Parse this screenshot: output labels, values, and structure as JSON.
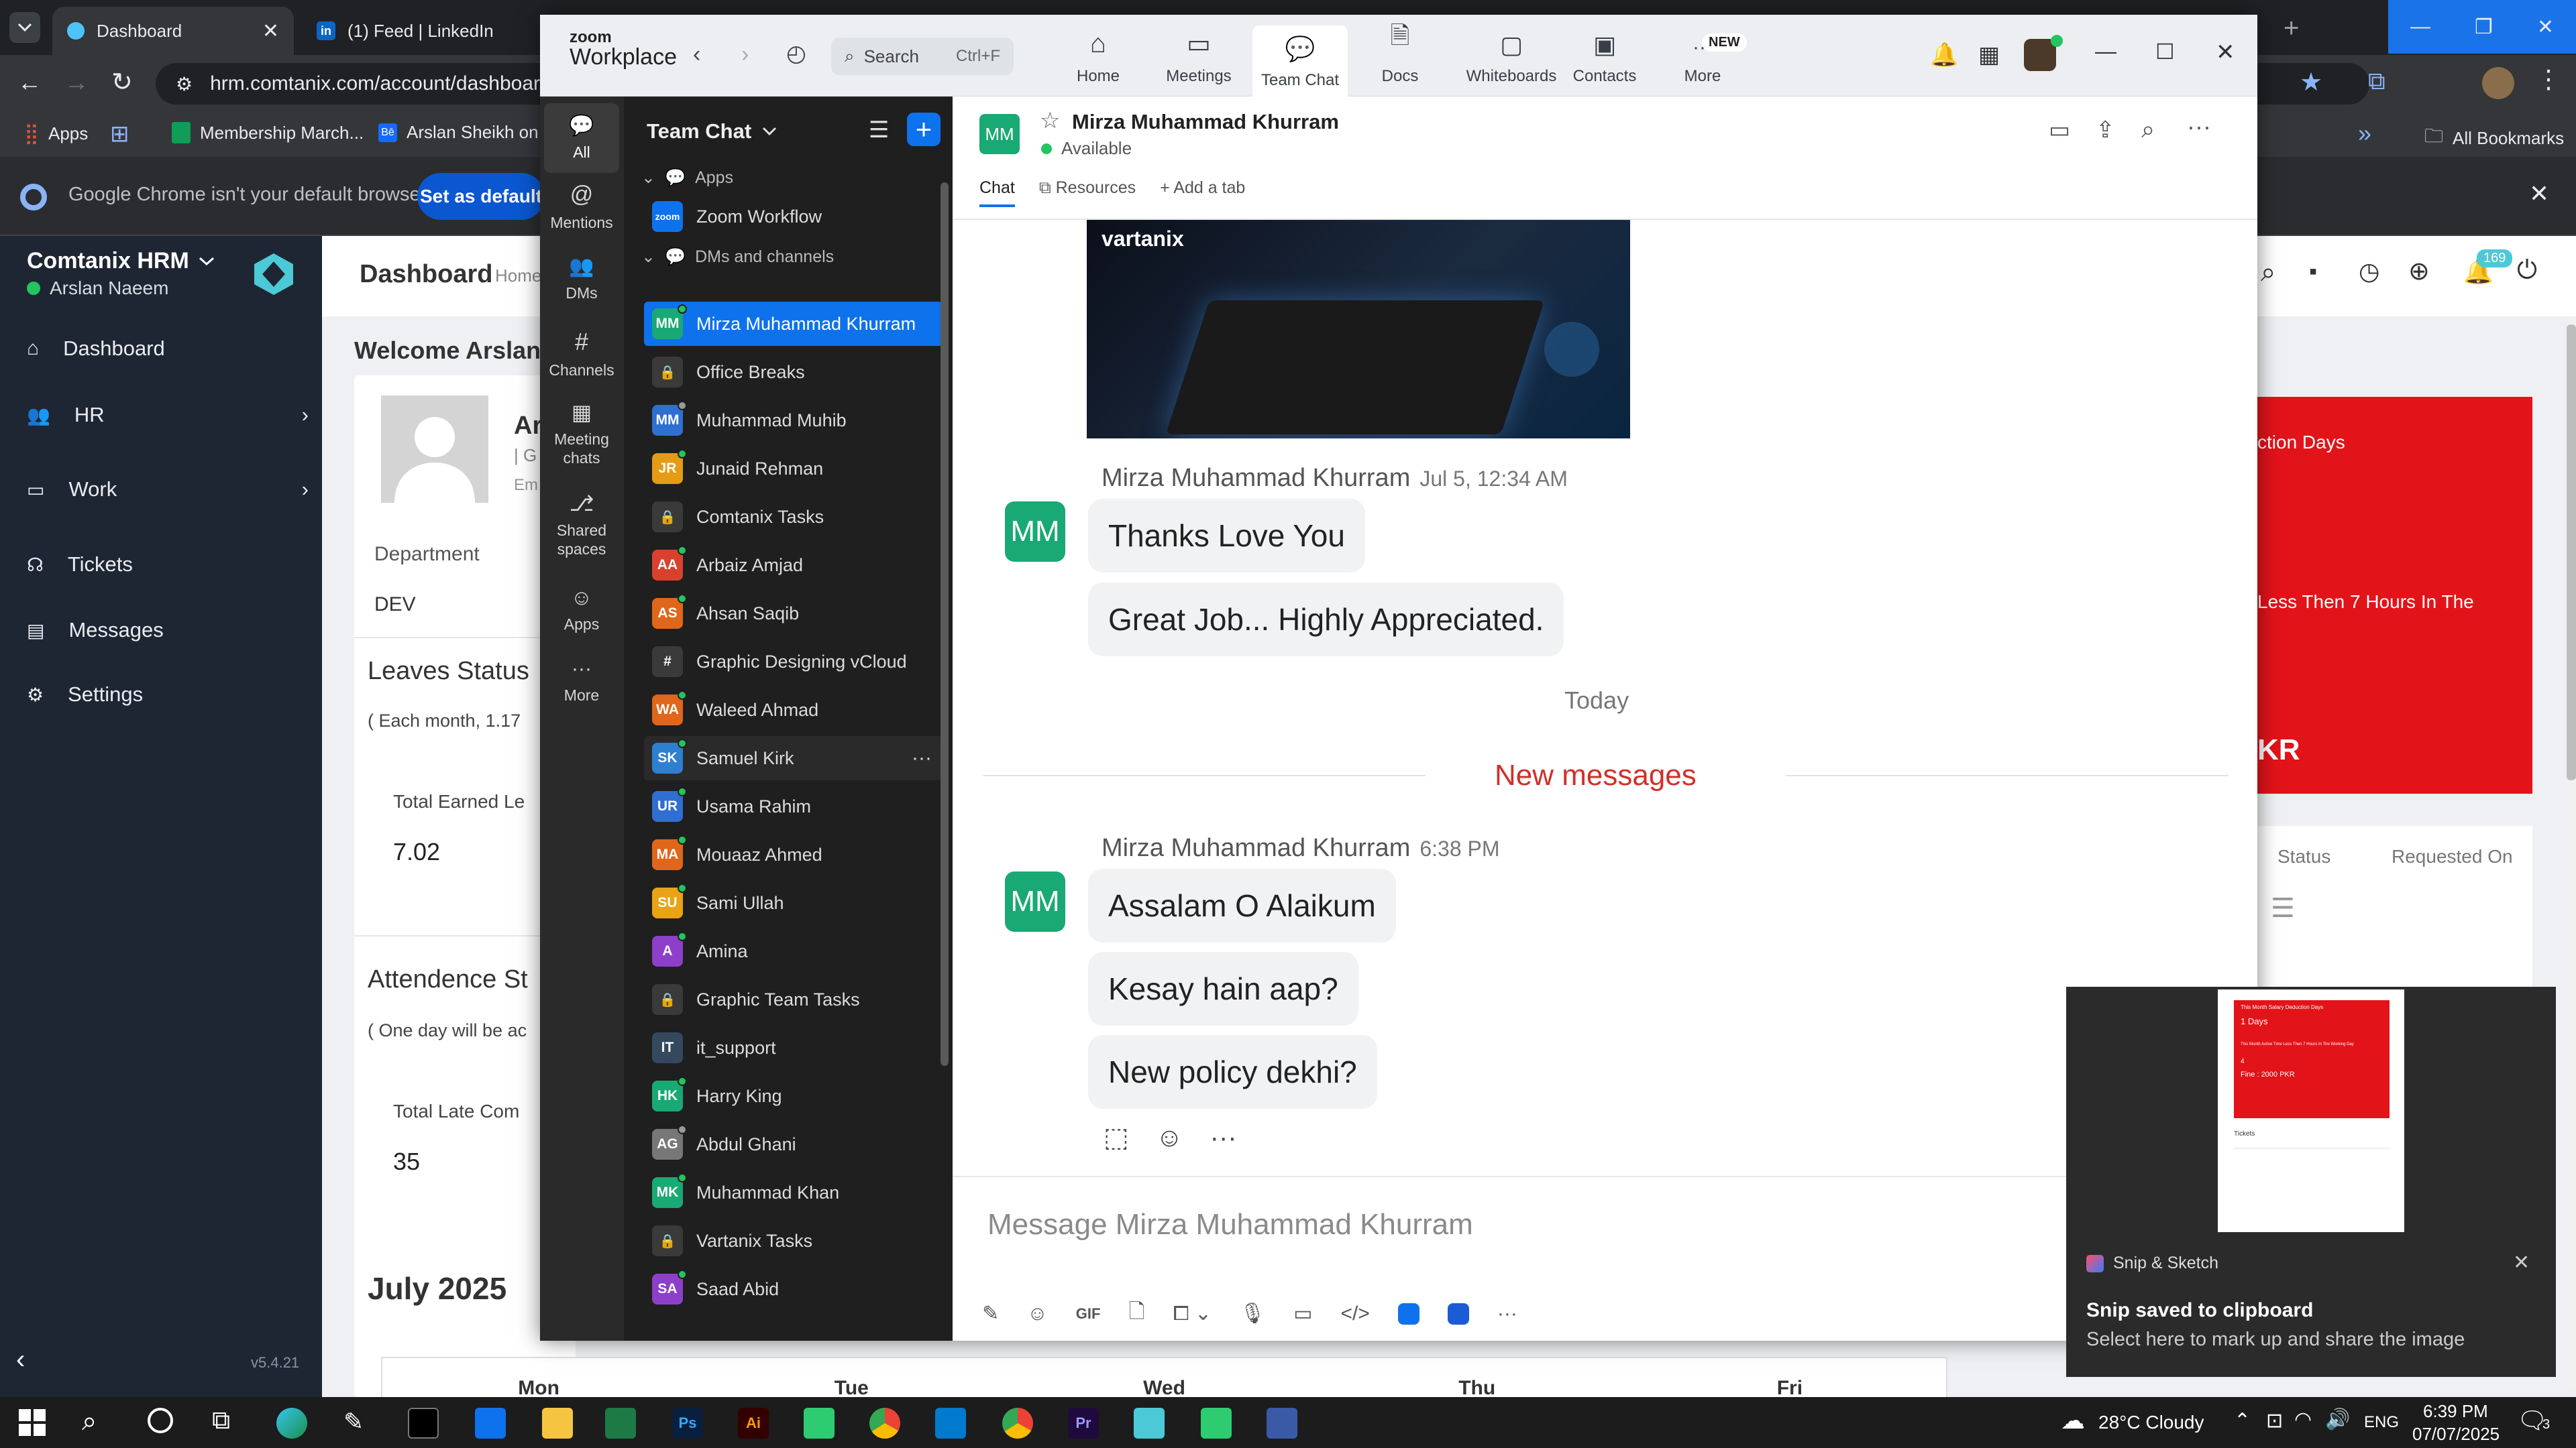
{
  "browser": {
    "tabs": [
      {
        "title": "Dashboard"
      },
      {
        "title": "(1) Feed | LinkedIn"
      }
    ],
    "url": "hrm.comtanix.com/account/dashboard",
    "bookmarks": [
      {
        "label": "Apps"
      },
      {
        "label": "Membership March..."
      },
      {
        "label": "Arslan Sheikh on E..."
      }
    ],
    "all_bookmarks": "All Bookmarks",
    "default_notice": "Google Chrome isn't your default browser",
    "set_default": "Set as default"
  },
  "hrm": {
    "brand": "Comtanix HRM",
    "user": "Arslan Naeem",
    "version": "v5.4.21",
    "nav": [
      {
        "label": "Dashboard"
      },
      {
        "label": "HR"
      },
      {
        "label": "Work"
      },
      {
        "label": "Tickets"
      },
      {
        "label": "Messages"
      },
      {
        "label": "Settings"
      }
    ],
    "page_title": "Dashboard",
    "breadcrumb": "Home",
    "welcome": "Welcome Arslan",
    "profile_initial": "Ar",
    "profile_sub": "| G",
    "profile_em": "Em",
    "department_label": "Department",
    "department_value": "DEV",
    "leaves_title": "Leaves Status",
    "leaves_note": "( Each month, 1.17",
    "total_earned_label": "Total Earned Le",
    "total_earned_value": "7.02",
    "attendance_title": "Attendence St",
    "attendance_note": "( One day will be ac",
    "total_late_label": "Total Late Com",
    "total_late_value": "35",
    "calendar_title": "July 2025",
    "weekdays": [
      "Mon",
      "Tue",
      "Wed",
      "Thu",
      "Fri"
    ],
    "red_card": {
      "line1": "ction Days",
      "line2": "Less Then 7 Hours In The",
      "line3": "KR"
    },
    "table_headers": [
      "Status",
      "Requested On"
    ],
    "notif_count": "169"
  },
  "zoom": {
    "brand_top": "zoom",
    "brand_bottom": "Workplace",
    "search_placeholder": "Search",
    "search_shortcut": "Ctrl+F",
    "top_tabs": [
      {
        "label": "Home"
      },
      {
        "label": "Meetings"
      },
      {
        "label": "Team Chat"
      },
      {
        "label": "Docs"
      },
      {
        "label": "Whiteboards"
      },
      {
        "label": "Contacts"
      },
      {
        "label": "More"
      }
    ],
    "new_badge": "NEW",
    "rail": [
      {
        "label": "All"
      },
      {
        "label": "Mentions"
      },
      {
        "label": "DMs"
      },
      {
        "label": "Channels"
      },
      {
        "label": "Meeting chats"
      },
      {
        "label": "Shared spaces"
      },
      {
        "label": "Apps"
      },
      {
        "label": "More"
      }
    ],
    "list_title": "Team Chat",
    "section_apps": "Apps",
    "zoom_workflow": "Zoom Workflow",
    "section_dms": "DMs and channels",
    "contacts": [
      {
        "name": "Mirza Muhammad Khurram",
        "initials": "MM",
        "color": "#19a974"
      },
      {
        "name": "Office Breaks",
        "initials": "",
        "color": "#3a3a3a"
      },
      {
        "name": "Muhammad Muhib",
        "initials": "MM",
        "color": "#2f6fd1"
      },
      {
        "name": "Junaid Rehman",
        "initials": "JR",
        "color": "#e49b16"
      },
      {
        "name": "Comtanix Tasks",
        "initials": "",
        "color": "#3a3a3a"
      },
      {
        "name": "Arbaiz Amjad",
        "initials": "AA",
        "color": "#d9412e"
      },
      {
        "name": "Ahsan Saqib",
        "initials": "AS",
        "color": "#e0661b"
      },
      {
        "name": "Graphic Designing vCloud",
        "initials": "#",
        "color": "#3a3a3a"
      },
      {
        "name": "Waleed Ahmad",
        "initials": "WA",
        "color": "#e0661b"
      },
      {
        "name": "Samuel Kirk",
        "initials": "SK",
        "color": "#2f7fd1"
      },
      {
        "name": "Usama Rahim",
        "initials": "UR",
        "color": "#2f6fd1"
      },
      {
        "name": "Mouaaz Ahmed",
        "initials": "MA",
        "color": "#e0661b"
      },
      {
        "name": "Sami Ullah",
        "initials": "SU",
        "color": "#e8a316"
      },
      {
        "name": "Amina",
        "initials": "A",
        "color": "#8e3fc9"
      },
      {
        "name": "Graphic Team Tasks",
        "initials": "",
        "color": "#3a3a3a"
      },
      {
        "name": "it_support",
        "initials": "IT",
        "color": "#34495e"
      },
      {
        "name": "Harry King",
        "initials": "HK",
        "color": "#19a974"
      },
      {
        "name": "Abdul Ghani",
        "initials": "AG",
        "color": "#777777"
      },
      {
        "name": "Muhammad Khan",
        "initials": "MK",
        "color": "#19a974"
      },
      {
        "name": "Vartanix Tasks",
        "initials": "",
        "color": "#3a3a3a"
      },
      {
        "name": "Saad Abid",
        "initials": "SA",
        "color": "#8e3fc9"
      }
    ],
    "chat": {
      "contact_initials": "MM",
      "contact_name": "Mirza Muhammad Khurram",
      "status": "Available",
      "tabs": [
        {
          "label": "Chat"
        },
        {
          "label": "Resources"
        },
        {
          "label": "Add a tab"
        }
      ],
      "image_brand": "vartanix",
      "sender": "Mirza Muhammad Khurram",
      "time1": "Jul 5, 12:34 AM",
      "msg1": "Thanks Love You",
      "msg2": "Great Job... Highly Appreciated.",
      "today": "Today",
      "new_messages": "New messages",
      "time2": "6:38 PM",
      "msg3": "Assalam O Alaikum",
      "msg4": "Kesay hain aap?",
      "msg5": "New policy dekhi?",
      "compose_placeholder": "Message Mirza Muhammad Khurram",
      "gif_label": "GIF"
    }
  },
  "toast": {
    "app": "Snip & Sketch",
    "title": "Snip saved to clipboard",
    "body": "Select here to mark up and share the image",
    "preview": {
      "header": "This Month Salary Deduction Days",
      "days": "1 Days",
      "line": "This Month Active Time Less Then 7 Hours In The Working Day",
      "count": "4",
      "fine": "Fine : 2000 PKR",
      "tickets": "Tickets"
    }
  },
  "taskbar": {
    "weather": "28°C  Cloudy",
    "lang": "ENG",
    "time": "6:39 PM",
    "date": "07/07/2025",
    "notif": "3"
  }
}
